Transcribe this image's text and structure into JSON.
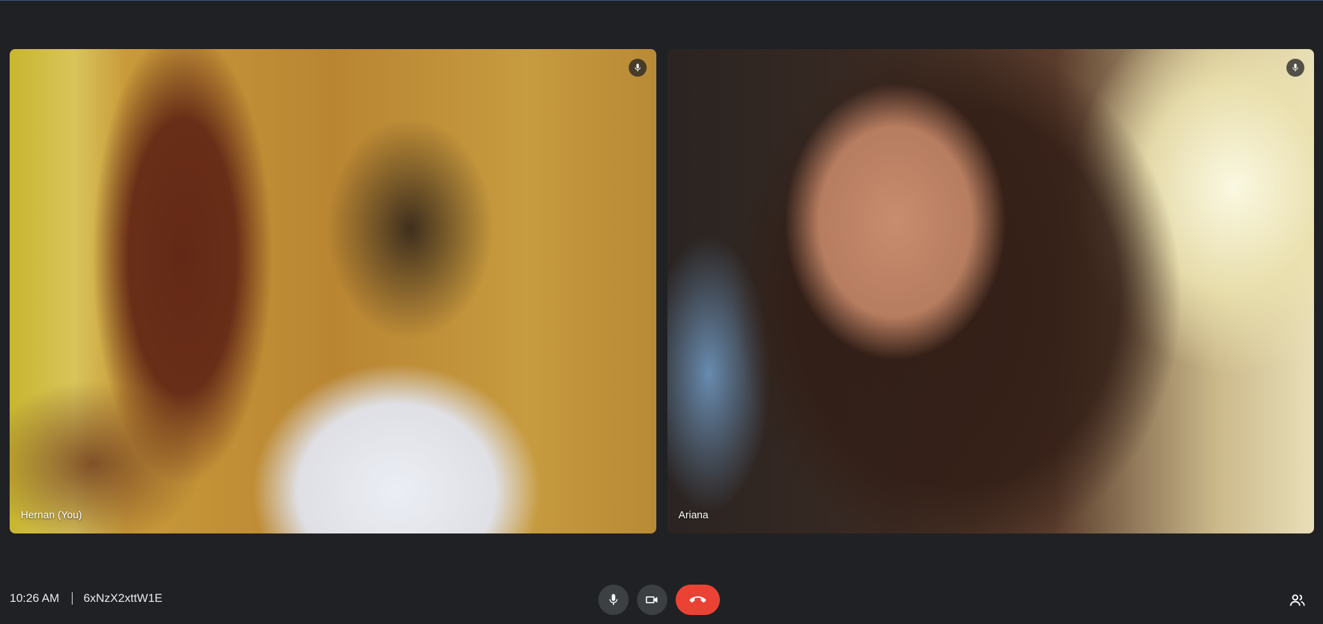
{
  "participants": [
    {
      "name": "Hernan (You)",
      "mic_icon": "mic-icon"
    },
    {
      "name": "Ariana",
      "mic_icon": "mic-icon"
    }
  ],
  "meeting": {
    "time": "10:26 AM",
    "code": "6xNzX2xttW1E"
  },
  "controls": {
    "mic_icon": "mic-icon",
    "camera_icon": "videocam-icon",
    "end_call_icon": "call-end-icon",
    "people_icon": "people-icon"
  },
  "colors": {
    "background": "#202124",
    "control_button": "#3c4043",
    "end_call": "#ea4335",
    "text": "#e8eaed"
  }
}
